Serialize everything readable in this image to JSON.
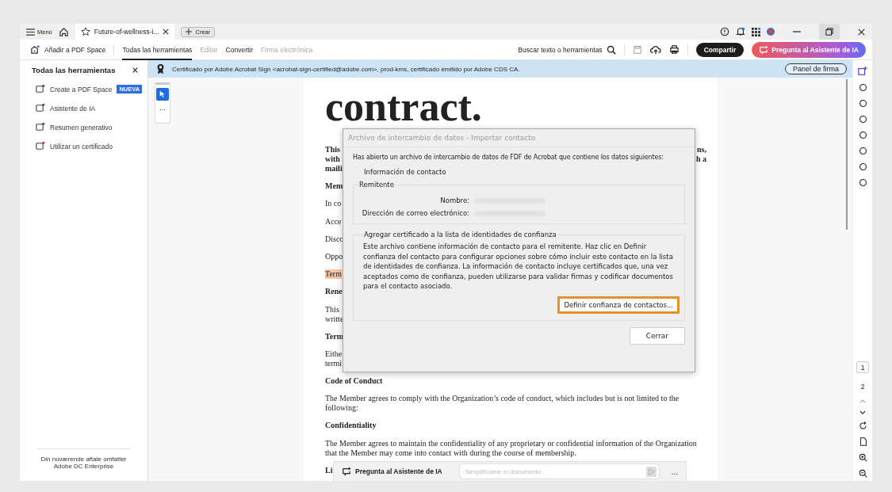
{
  "title_bar": {
    "menu": "Menú",
    "tabs": [
      {
        "label": "Future-of-wellness-i...",
        "selected": true
      }
    ],
    "new_tab": "Crear"
  },
  "toolbar": {
    "add_space": "Añadir a PDF Space",
    "tabs": [
      {
        "label": "Todas las herramientas",
        "selected": true,
        "disabled": false
      },
      {
        "label": "Editar",
        "selected": false,
        "disabled": true
      },
      {
        "label": "Convertir",
        "selected": false,
        "disabled": false
      },
      {
        "label": "Firma electrónica",
        "selected": false,
        "disabled": true
      }
    ],
    "search": "Buscar texto o herramientas",
    "share": "Compartir",
    "ai_button": "Pregunta al Asistente de IA"
  },
  "tools_panel": {
    "title": "Todas las herramientas",
    "items": [
      {
        "label": "Create a PDF Space",
        "badge": "NUEVA"
      },
      {
        "label": "Asistente de IA"
      },
      {
        "label": "Resumen generativo"
      },
      {
        "label": "Utilizar un certificado"
      }
    ],
    "footer": "Din nuværende aftale omfatter Adobe DC Enterprise"
  },
  "cert_banner": {
    "text": "Certificado por Adobe Acrobat Sign <acrobat-sign-certified@adobe.com>, prod-kms, certificado emitido por Adobe CDS CA.",
    "button": "Panel de firma"
  },
  "mini_toolbar": {
    "more": "..."
  },
  "document": {
    "title": "contract.",
    "blocks": [
      {
        "kind": "heading",
        "lines": [
          {
            "text": "This",
            "end": "ns,"
          },
          {
            "text": "with",
            "end": "h a"
          },
          {
            "text": "maili"
          }
        ]
      },
      {
        "kind": "heading",
        "lines": [
          {
            "text": "Mem"
          }
        ]
      },
      {
        "kind": "body",
        "lines": [
          {
            "text": "In co"
          }
        ]
      },
      {
        "kind": "body",
        "lines": [
          {
            "text": "Acce"
          }
        ]
      },
      {
        "kind": "body",
        "lines": [
          {
            "text": "Disco"
          }
        ]
      },
      {
        "kind": "body",
        "lines": [
          {
            "text": "Oppo"
          }
        ]
      },
      {
        "kind": "highlight",
        "lines": [
          {
            "text": "Term"
          }
        ]
      },
      {
        "kind": "heading",
        "lines": [
          {
            "text": "Rene"
          }
        ]
      },
      {
        "kind": "body",
        "lines": [
          {
            "text": "This"
          },
          {
            "text": "writte"
          }
        ]
      },
      {
        "kind": "heading",
        "lines": [
          {
            "text": "Term"
          }
        ]
      },
      {
        "kind": "body",
        "lines": [
          {
            "text": "Eithe"
          },
          {
            "text": "termi"
          }
        ]
      },
      {
        "kind": "heading",
        "lines": [
          {
            "text": "Code of Conduct"
          }
        ]
      },
      {
        "kind": "body",
        "lines": [
          {
            "text": "The Member agrees to comply with the Organization’s code of conduct, which includes but is not limited to the following:"
          }
        ]
      },
      {
        "kind": "heading",
        "lines": [
          {
            "text": "Confidentiality"
          }
        ]
      },
      {
        "kind": "body",
        "lines": [
          {
            "text": "The Member agrees to maintain the confidentiality of any proprietary or confidential information of the Organization that the Member may come into contact with during the course of membership."
          }
        ]
      },
      {
        "kind": "heading",
        "lines": [
          {
            "text": "Li"
          }
        ]
      }
    ]
  },
  "dialog": {
    "title": "Archivo de intercambio de datos - Importar contacto",
    "intro": "Has abierto un archivo de intercambio de datos de FDF de Acrobat que contiene los datos siguientes:",
    "section": "Información de contacto",
    "sender": {
      "legend": "Remitente",
      "fields": [
        {
          "label": "Nombre:"
        },
        {
          "label": "Dirección de correo electrónico:"
        }
      ]
    },
    "trust": {
      "legend": "Agregar certificado a la lista de identidades de confianza",
      "text": "Este archivo contiene información de contacto para el remitente. Haz clic en Definir confianza del contacto para configurar opciones sobre cómo incluir este contacto en la lista de identidades de confianza. La información de contacto incluye certificados que, una vez aceptados como de confianza, pueden utilizarse para validar firmas y codificar documentos para el contacto asociado.",
      "button": "Definir confianza de contactos..."
    },
    "close": "Cerrar"
  },
  "ai_bar": {
    "label": "Pregunta al Asistente de IA",
    "placeholder": "Simplifícame el documento",
    "more": "..."
  },
  "page_nav": {
    "pages": [
      {
        "label": "1",
        "selected": true
      },
      {
        "label": "2",
        "selected": false
      }
    ]
  }
}
